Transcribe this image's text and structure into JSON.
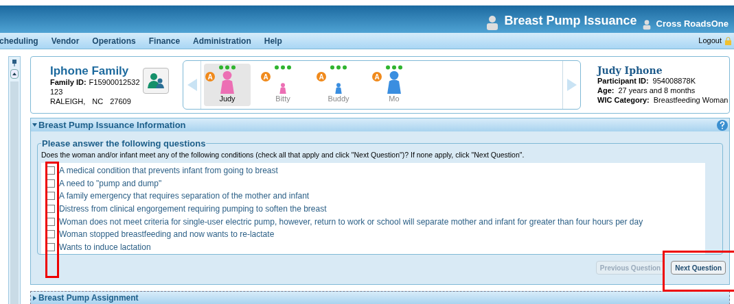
{
  "header": {
    "title": "Breast Pump Issuance",
    "user": "Cross RoadsOne"
  },
  "menu": [
    {
      "label": "cheduling"
    },
    {
      "label": "Vendor"
    },
    {
      "label": "Operations"
    },
    {
      "label": "Finance"
    },
    {
      "label": "Administration"
    },
    {
      "label": "Help"
    }
  ],
  "logout": "Logout",
  "family": {
    "name": "Iphone Family",
    "id_label": "Family ID:",
    "id": "F15900012532",
    "address": "123",
    "city": "RALEIGH,",
    "state": "NC",
    "zip": "27609"
  },
  "members": [
    {
      "name": "Judy",
      "selected": true,
      "kind": "adult",
      "color": "#ec6fb4",
      "badge": "A"
    },
    {
      "name": "Bitty",
      "selected": false,
      "kind": "infant",
      "color": "#ec6fb4",
      "badge": "A"
    },
    {
      "name": "Buddy",
      "selected": false,
      "kind": "infant",
      "color": "#3a8ee0",
      "badge": "A"
    },
    {
      "name": "Mo",
      "selected": false,
      "kind": "adult",
      "color": "#3a8ee0",
      "badge": "A"
    }
  ],
  "participant": {
    "name": "Judy Iphone",
    "fields": [
      {
        "label": "Participant ID:",
        "value": "954008878K"
      },
      {
        "label": "Age:",
        "value": "27 years and 8 months"
      },
      {
        "label": "WIC Category:",
        "value": "Breastfeeding Woman"
      }
    ]
  },
  "section": {
    "title": "Breast Pump Issuance Information",
    "expanded": true
  },
  "questions": {
    "legend": "Please answer the following questions",
    "prompt": "Does the woman and/or infant meet any of the following conditions (check all that apply and click \"Next Question\")? If none apply, click \"Next Question\".",
    "items": [
      {
        "label": "A medical condition that prevents infant from going to breast",
        "checked": false
      },
      {
        "label": "A need to \"pump and dump\"",
        "checked": false
      },
      {
        "label": "A family emergency that requires separation of the mother and infant",
        "checked": false
      },
      {
        "label": "Distress from clinical engorgement requiring pumping to soften the breast",
        "checked": false
      },
      {
        "label": "Woman does not meet criteria for single-user electric pump, however, return to work or school will separate mother and infant for greater than four hours per day",
        "checked": false
      },
      {
        "label": "Woman stopped breastfeeding and now wants to re-lactate",
        "checked": false
      },
      {
        "label": "Wants to induce lactation",
        "checked": false
      }
    ]
  },
  "buttons": [
    {
      "label": "Previous Question",
      "disabled": true
    },
    {
      "label": "Next Question",
      "disabled": false
    }
  ],
  "next_section": {
    "title": "Breast Pump Assignment",
    "expanded": false
  }
}
